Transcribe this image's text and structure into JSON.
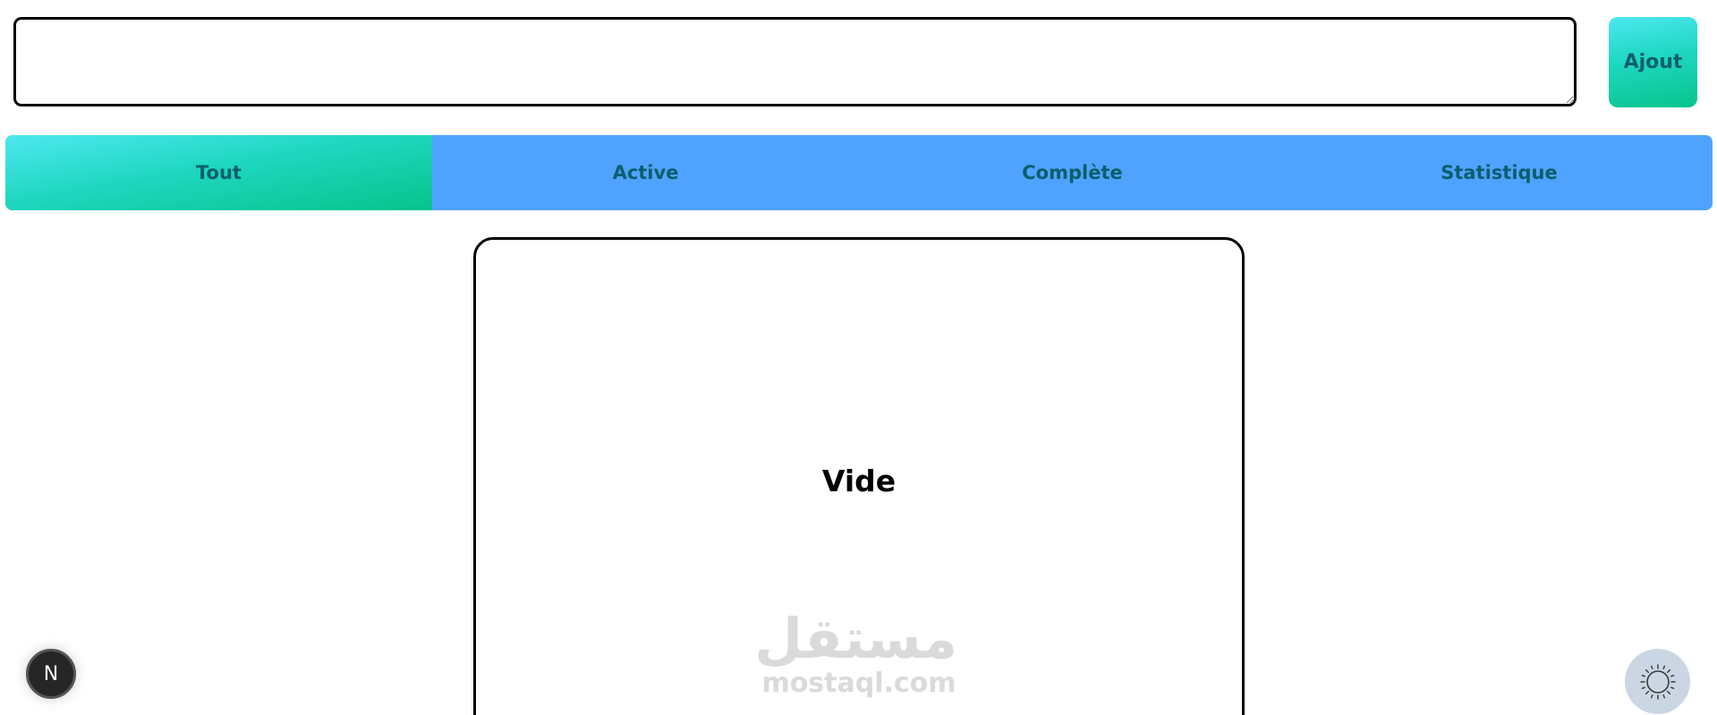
{
  "task_input": {
    "value": "",
    "placeholder": ""
  },
  "add_button": {
    "label": "Ajout"
  },
  "tabs": [
    {
      "label": "Tout",
      "selected": true
    },
    {
      "label": "Active",
      "selected": false
    },
    {
      "label": "Complète",
      "selected": false
    },
    {
      "label": "Statistique",
      "selected": false
    }
  ],
  "empty_state": {
    "text": "Vide"
  },
  "watermark": {
    "arabic_text": "مستقل",
    "latin_text": "mostaql.com"
  },
  "nav_badge": {
    "letter": "N",
    "icon": "nextjs-logo-icon"
  },
  "theme_toggle": {
    "icon": "sun-icon"
  },
  "colors": {
    "tab_bar": "#4fa3fe",
    "accent_gradient_start": "#4ee8f0",
    "accent_gradient_end": "#06c38b",
    "tab_text": "#0a5f6c",
    "theme_toggle_bg": "#cad6e3"
  }
}
